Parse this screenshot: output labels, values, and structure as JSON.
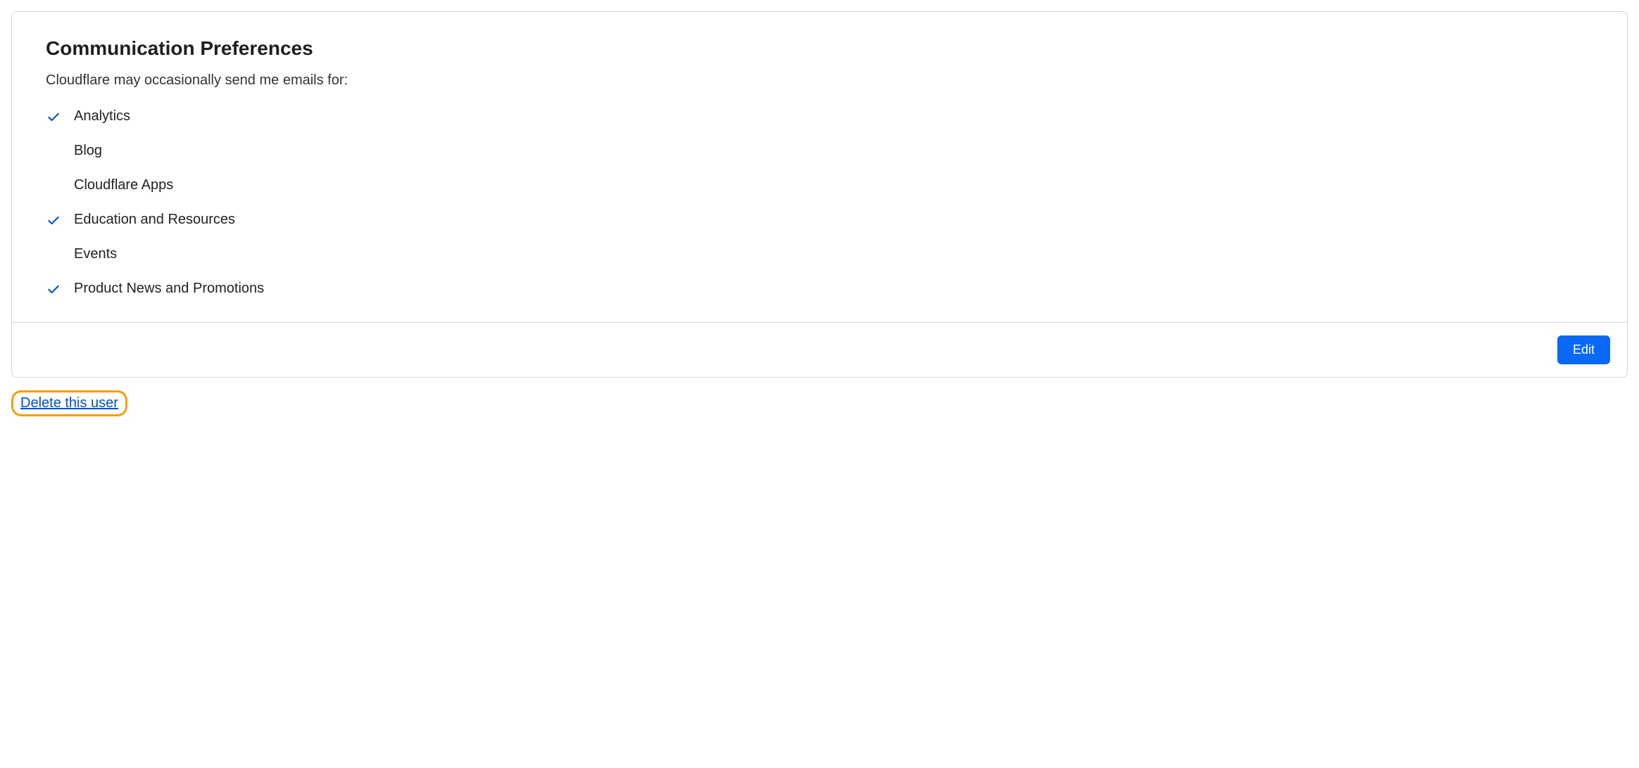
{
  "card": {
    "title": "Communication Preferences",
    "subtitle": "Cloudflare may occasionally send me emails for:",
    "preferences": [
      {
        "label": "Analytics",
        "checked": true
      },
      {
        "label": "Blog",
        "checked": false
      },
      {
        "label": "Cloudflare Apps",
        "checked": false
      },
      {
        "label": "Education and Resources",
        "checked": true
      },
      {
        "label": "Events",
        "checked": false
      },
      {
        "label": "Product News and Promotions",
        "checked": true
      }
    ],
    "edit_label": "Edit"
  },
  "delete_link_label": "Delete this user"
}
